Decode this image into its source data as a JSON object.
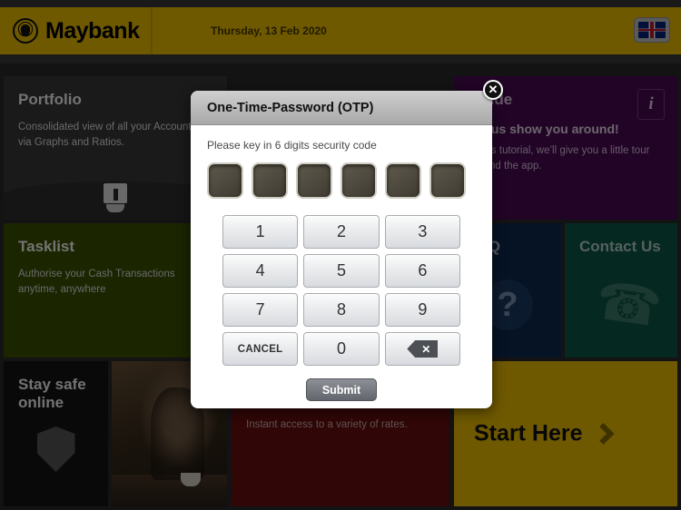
{
  "header": {
    "brand": "Maybank",
    "date": "Thursday, 13 Feb 2020",
    "logo_icon": "maybank-tiger-logo",
    "language_icon": "uk-flag-icon"
  },
  "tiles": {
    "portfolio": {
      "title": "Portfolio",
      "body": "Consolidated view of all your Accounts via Graphs and Ratios.",
      "icon": "chart-monitor-icon"
    },
    "tasklist": {
      "title": "Tasklist",
      "body": "Authorise your Cash Transactions anytime, anywhere"
    },
    "staysafe": {
      "title": "Stay safe online",
      "icon": "shield-icon"
    },
    "photo": {
      "alt": "relaxed-person-with-headphones-photo"
    },
    "rates": {
      "body": "Instant access to a variety of rates."
    },
    "guide": {
      "title": "Guide",
      "lead": "Let us show you around!",
      "body": "In this tutorial, we’ll give you a little tour around the app.",
      "icon": "info-icon"
    },
    "faq": {
      "title": "FAQ",
      "icon": "question-mark-icon"
    },
    "contact": {
      "title": "Contact Us",
      "icon": "phone-icon"
    },
    "start": {
      "title": "Start Here",
      "icon": "chevron-right-icon"
    }
  },
  "modal": {
    "title": "One-Time-Password (OTP)",
    "hint": "Please key in 6 digits security code",
    "close_label": "✕",
    "otp_digit_count": 6,
    "otp_values": [
      "",
      "",
      "",
      "",
      "",
      ""
    ],
    "keypad": [
      "1",
      "2",
      "3",
      "4",
      "5",
      "6",
      "7",
      "8",
      "9",
      "CANCEL",
      "0",
      "✕"
    ],
    "backspace_label": "✕",
    "cancel_label": "CANCEL",
    "submit_label": "Submit"
  },
  "colors": {
    "brand_yellow": "#f5c400",
    "purple": "#4c0a56",
    "navy": "#0d2a52",
    "teal": "#0b5a48",
    "olive": "#3d5200",
    "red": "#6b0d0d"
  }
}
